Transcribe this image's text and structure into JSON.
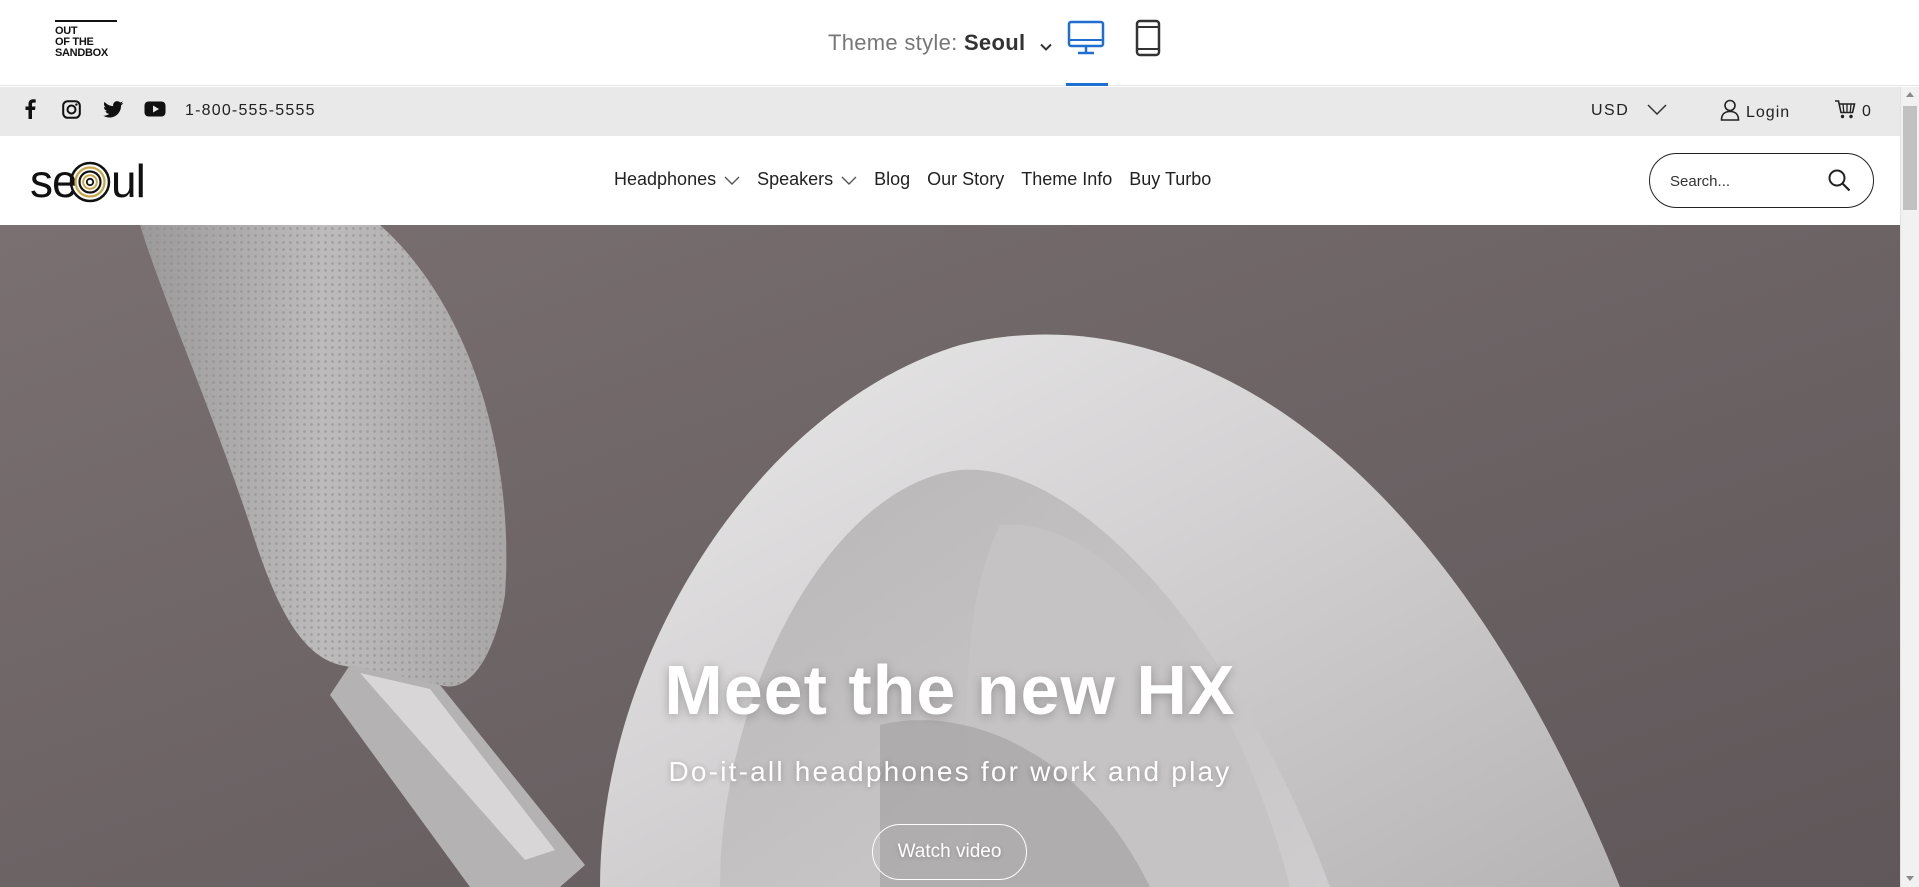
{
  "preview_bar": {
    "logo_lines": [
      "OUT",
      "OF THE",
      "SANDBOX"
    ],
    "theme_style_label": "Theme style:",
    "theme_style_value": "Seoul",
    "devices": [
      {
        "name": "desktop",
        "active": true
      },
      {
        "name": "mobile",
        "active": false
      }
    ],
    "accent_color": "#1f6fd1"
  },
  "topbar": {
    "social_icons": [
      "facebook-icon",
      "instagram-icon",
      "twitter-icon",
      "youtube-icon"
    ],
    "phone": "1-800-555-5555",
    "currency": "USD",
    "login_label": "Login",
    "cart_count": "0"
  },
  "header": {
    "brand": "seoul",
    "nav": [
      {
        "label": "Headphones",
        "has_dropdown": true
      },
      {
        "label": "Speakers",
        "has_dropdown": true
      },
      {
        "label": "Blog",
        "has_dropdown": false
      },
      {
        "label": "Our Story",
        "has_dropdown": false
      },
      {
        "label": "Theme Info",
        "has_dropdown": false
      },
      {
        "label": "Buy Turbo",
        "has_dropdown": false
      }
    ],
    "search_placeholder": "Search..."
  },
  "hero": {
    "title": "Meet the new HX",
    "subtitle": "Do-it-all headphones for work and play",
    "cta_label": "Watch video",
    "background_color": "#6f6667"
  }
}
